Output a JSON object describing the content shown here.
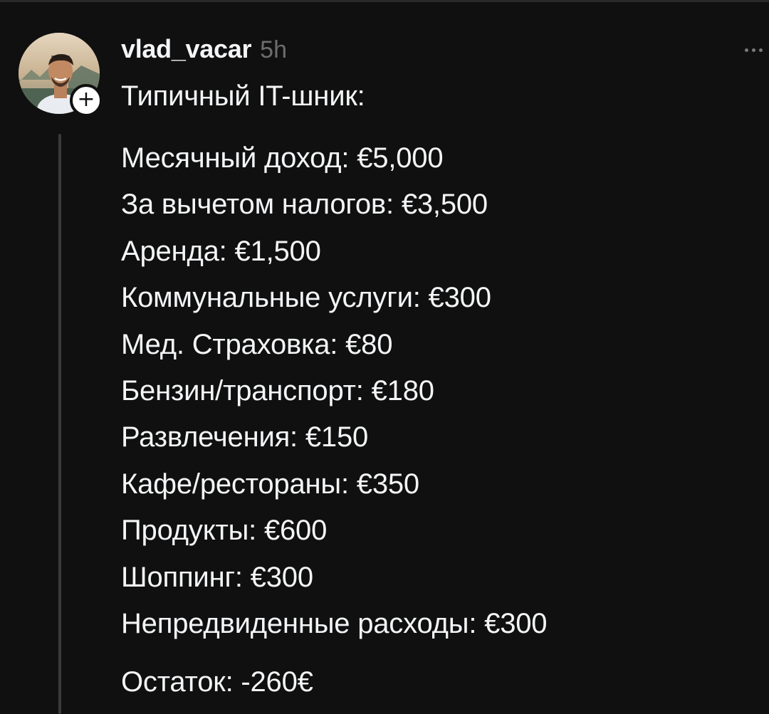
{
  "post": {
    "username": "vlad_vacar",
    "timestamp": "5h",
    "more_icon": "more-horizontal-icon",
    "follow_icon": "plus-icon",
    "follow_glyph": "+",
    "intro": "Типичный IT-шник:",
    "budget_lines": [
      "Месячный доход: €5,000",
      "За вычетом налогов: €3,500",
      "Аренда: €1,500",
      "Коммунальные услуги: €300",
      "Мед. Страховка: €80",
      "Бензин/транспорт: €180",
      "Развлечения: €150",
      "Кафе/рестораны: €350",
      "Продукты: €600",
      "Шоппинг: €300",
      "Непредвиденные расходы: €300"
    ],
    "remainder": "Остаток: -260€"
  },
  "colors": {
    "background": "#101010",
    "text": "#f3f5f7",
    "muted": "#6d6d6d",
    "thread_line": "#3a3a3a"
  }
}
